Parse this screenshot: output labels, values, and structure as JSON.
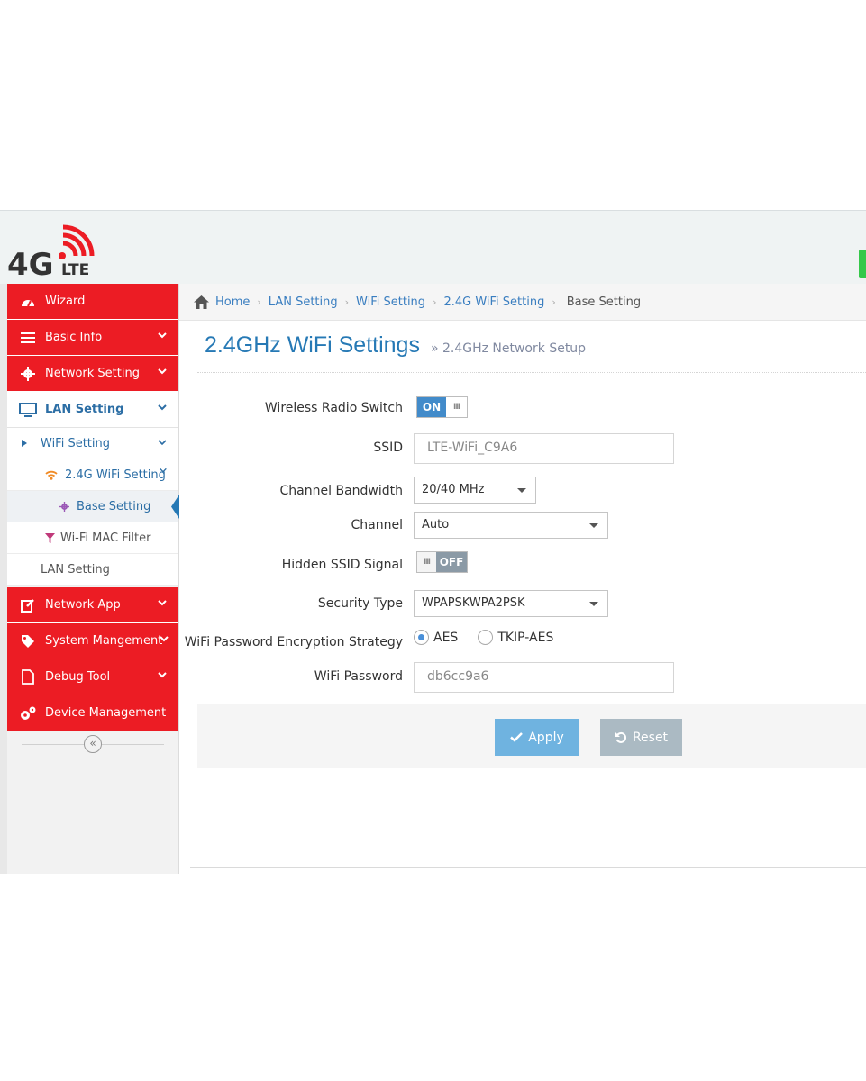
{
  "logo": {
    "text_main": "4G",
    "text_sub": "LTE"
  },
  "colors": {
    "brand_red": "#ec1c24",
    "accent_blue": "#2679b5",
    "link_blue": "#3a7ec0",
    "apply_blue": "#6fb3e0",
    "reset_gray": "#abbac3",
    "toggle_blue": "#428bca"
  },
  "sidebar": {
    "items": [
      {
        "label": "Wizard",
        "icon": "dashboard-icon"
      },
      {
        "label": "Basic Info",
        "icon": "list-icon"
      },
      {
        "label": "Network Setting",
        "icon": "gear-icon"
      },
      {
        "label": "LAN Setting",
        "icon": "monitor-icon"
      },
      {
        "label": "Network App",
        "icon": "edit-icon"
      },
      {
        "label": "System Mangement",
        "icon": "tag-icon"
      },
      {
        "label": "Debug Tool",
        "icon": "file-icon"
      },
      {
        "label": "Device Management",
        "icon": "gears-icon"
      }
    ],
    "sub": {
      "wifi_setting": "WiFi Setting",
      "wifi_24g": "2.4G WiFi Setting",
      "base_setting": "Base Setting",
      "mac_filter": "Wi-Fi MAC Filter",
      "lan_setting": "LAN Setting"
    },
    "collapse_glyph": "«"
  },
  "breadcrumb": {
    "home": "Home",
    "items": [
      "LAN Setting",
      "WiFi Setting",
      "2.4G WiFi Setting"
    ],
    "current": "Base Setting",
    "separator": "›"
  },
  "page": {
    "title": "2.4GHz WiFi Settings",
    "subtitle": "» 2.4GHz Network Setup"
  },
  "form": {
    "wireless_radio": {
      "label": "Wireless Radio Switch",
      "state": "ON",
      "grip": "III"
    },
    "ssid": {
      "label": "SSID",
      "value": "LTE-WiFi_C9A6"
    },
    "bandwidth": {
      "label": "Channel Bandwidth",
      "value": "20/40 MHz"
    },
    "channel": {
      "label": "Channel",
      "value": "Auto"
    },
    "hidden_ssid": {
      "label": "Hidden SSID Signal",
      "state": "OFF",
      "grip": "III"
    },
    "security": {
      "label": "Security Type",
      "value": "WPAPSKWPA2PSK"
    },
    "encryption": {
      "label": "WiFi Password Encryption Strategy",
      "options": [
        "AES",
        "TKIP-AES"
      ],
      "selected": "AES"
    },
    "password": {
      "label": "WiFi Password",
      "value": "db6cc9a6"
    }
  },
  "actions": {
    "apply": "Apply",
    "reset": "Reset"
  }
}
